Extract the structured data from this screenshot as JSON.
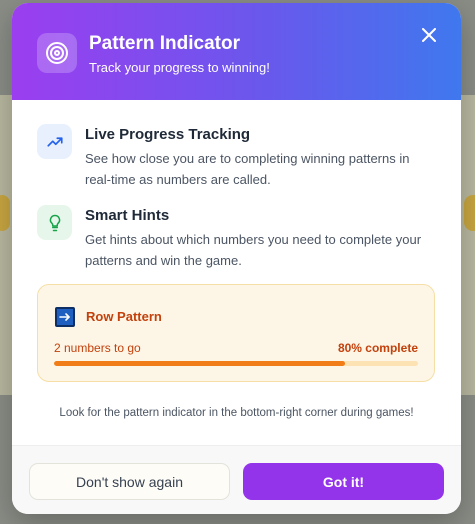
{
  "header": {
    "title": "Pattern Indicator",
    "subtitle": "Track your progress to winning!"
  },
  "features": [
    {
      "title": "Live Progress Tracking",
      "description": "See how close you are to completing winning patterns in real-time as numbers are called.",
      "icon": "trending-up-icon",
      "accent": "#2563eb"
    },
    {
      "title": "Smart Hints",
      "description": "Get hints about which numbers you need to complete your patterns and win the game.",
      "icon": "lightbulb-icon",
      "accent": "#16a34a"
    }
  ],
  "pattern": {
    "icon": "arrow-right-icon",
    "name": "Row Pattern",
    "numbers_to_go": "2 numbers to go",
    "percent_label": "80% complete",
    "progress": 0.8
  },
  "footer": {
    "note": "Look for the pattern indicator in the bottom-right corner during games!",
    "dont_show_label": "Don't show again",
    "got_it_label": "Got it!"
  },
  "colors": {
    "primary": "#9333ea",
    "header_gradient_start": "#9b3ef0",
    "header_gradient_end": "#3f78ee",
    "progress_fill": "#f07d17",
    "pattern_text": "#c2410c"
  }
}
